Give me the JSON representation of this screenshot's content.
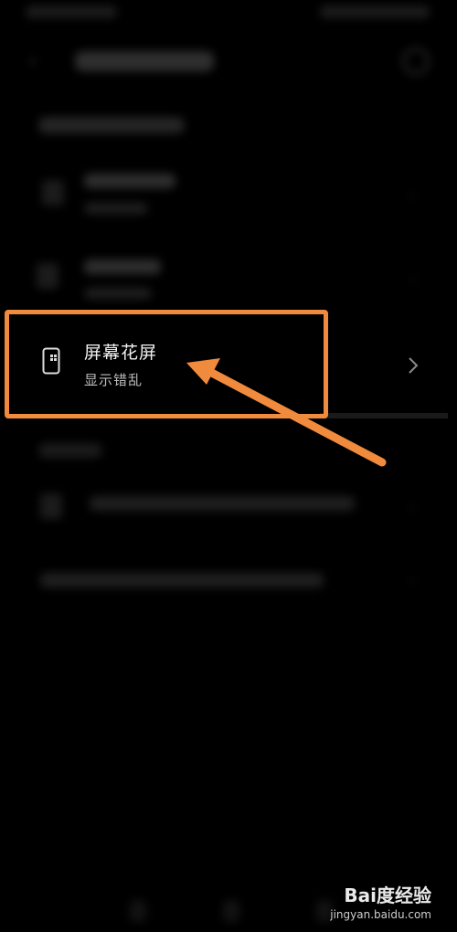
{
  "item": {
    "title": "屏幕花屏",
    "subtitle": "显示错乱",
    "icon": "phone-icon"
  },
  "watermark": {
    "logo": "Bai度经验",
    "site": "jingyan.baidu.com"
  },
  "colors": {
    "highlight": "#f08a3d",
    "background": "#000000"
  }
}
